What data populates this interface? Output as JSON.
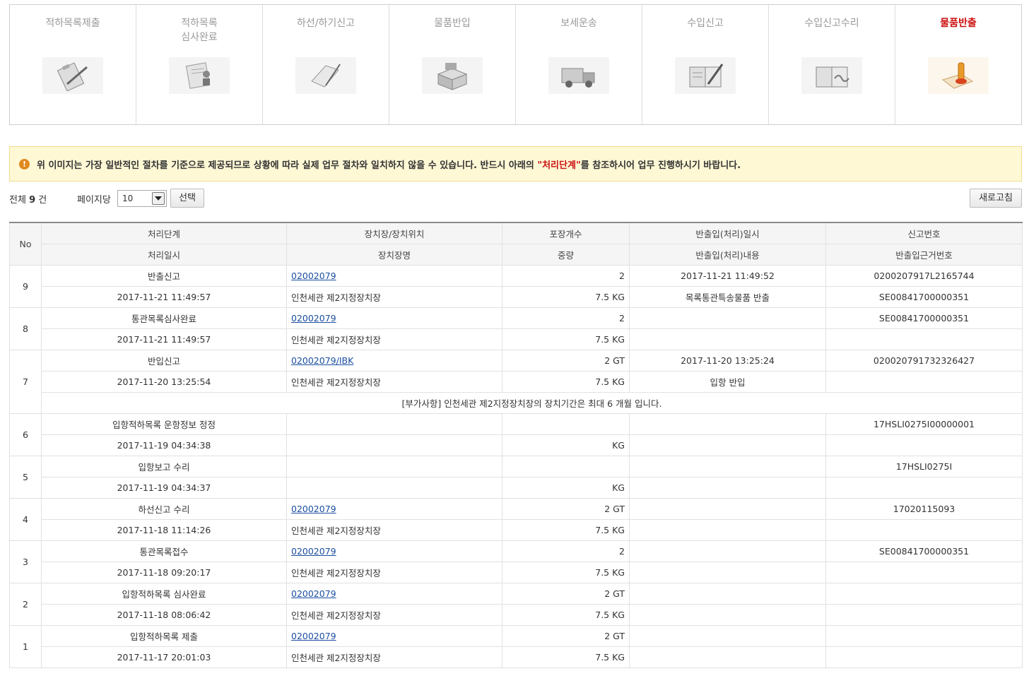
{
  "steps": [
    {
      "label": "적하목록제출",
      "icon": "clipboard-pencil-icon",
      "active": false
    },
    {
      "label": "적하목록\n심사완료",
      "icon": "stamp-document-icon",
      "active": false
    },
    {
      "label": "하선/하기신고",
      "icon": "pen-paper-icon",
      "active": false
    },
    {
      "label": "물품반입",
      "icon": "boxes-icon",
      "active": false
    },
    {
      "label": "보세운송",
      "icon": "truck-icon",
      "active": false
    },
    {
      "label": "수입신고",
      "icon": "book-pen-icon",
      "active": false
    },
    {
      "label": "수입신고수리",
      "icon": "book-signature-icon",
      "active": false
    },
    {
      "label": "물품반출",
      "icon": "seal-document-icon",
      "active": true
    }
  ],
  "notice": {
    "icon": "exclamation-icon",
    "text_before": "위 이미지는 가장 일반적인 절차를 기준으로 제공되므로 상황에 따라 실제 업무 절차와 일치하지 않을 수 있습니다. 반드시 아래의 ",
    "highlight": "\"처리단계\"",
    "text_after": "를 참조하시어 업무 진행하시기 바랍니다."
  },
  "toolbar": {
    "total_prefix": "전체",
    "total_count": "9",
    "total_suffix": "건",
    "perpage_label": "페이지당",
    "perpage_value": "10",
    "select_button": "선택",
    "refresh_button": "새로고침"
  },
  "table": {
    "headers": {
      "no": "No",
      "row1": [
        "처리단계",
        "장치장/장치위치",
        "포장개수",
        "반출입(처리)일시",
        "신고번호"
      ],
      "row2": [
        "처리일시",
        "장치장명",
        "중량",
        "반출입(처리)내용",
        "반출입근거번호"
      ]
    },
    "records": [
      {
        "no": "9",
        "step": "반출신고",
        "location": "02002079",
        "pkg": "2",
        "io_datetime": "2017-11-21 11:49:52",
        "decl_no": "0200207917L2165744",
        "datetime": "2017-11-21 11:49:57",
        "warehouse": "인천세관 제2지정장치장",
        "weight": "7.5 KG",
        "io_content": "목록통관특송물품 반출",
        "basis_no": "SE00841700000351"
      },
      {
        "no": "8",
        "step": "통관목록심사완료",
        "location": "02002079",
        "pkg": "2",
        "io_datetime": "",
        "decl_no": "SE00841700000351",
        "datetime": "2017-11-21 11:49:57",
        "warehouse": "인천세관 제2지정장치장",
        "weight": "7.5 KG",
        "io_content": "",
        "basis_no": ""
      },
      {
        "no": "7",
        "step": "반입신고",
        "location": "02002079/IBK",
        "pkg": "2 GT",
        "io_datetime": "2017-11-20 13:25:24",
        "decl_no": "020020791732326427",
        "datetime": "2017-11-20 13:25:54",
        "warehouse": "인천세관 제2지정장치장",
        "weight": "7.5 KG",
        "io_content": "입항 반입",
        "basis_no": "",
        "note": "[부가사항] 인천세관 제2지정장치장의 장치기간은 최대 6 개월 입니다."
      },
      {
        "no": "6",
        "step": "입항적하목록 운항정보 정정",
        "location": "",
        "pkg": "",
        "io_datetime": "",
        "decl_no": "17HSLI0275I00000001",
        "datetime": "2017-11-19 04:34:38",
        "warehouse": "",
        "weight": "KG",
        "io_content": "",
        "basis_no": ""
      },
      {
        "no": "5",
        "step": "입항보고 수리",
        "location": "",
        "pkg": "",
        "io_datetime": "",
        "decl_no": "17HSLI0275I",
        "datetime": "2017-11-19 04:34:37",
        "warehouse": "",
        "weight": "KG",
        "io_content": "",
        "basis_no": ""
      },
      {
        "no": "4",
        "step": "하선신고 수리",
        "location": "02002079",
        "pkg": "2 GT",
        "io_datetime": "",
        "decl_no": "17020115093",
        "datetime": "2017-11-18 11:14:26",
        "warehouse": "인천세관 제2지정장치장",
        "weight": "7.5 KG",
        "io_content": "",
        "basis_no": ""
      },
      {
        "no": "3",
        "step": "통관목록접수",
        "location": "02002079",
        "pkg": "2",
        "io_datetime": "",
        "decl_no": "SE00841700000351",
        "datetime": "2017-11-18 09:20:17",
        "warehouse": "인천세관 제2지정장치장",
        "weight": "7.5 KG",
        "io_content": "",
        "basis_no": ""
      },
      {
        "no": "2",
        "step": "입항적하목록 심사완료",
        "location": "02002079",
        "pkg": "2 GT",
        "io_datetime": "",
        "decl_no": "",
        "datetime": "2017-11-18 08:06:42",
        "warehouse": "인천세관 제2지정장치장",
        "weight": "7.5 KG",
        "io_content": "",
        "basis_no": ""
      },
      {
        "no": "1",
        "step": "입항적하목록 제출",
        "location": "02002079",
        "pkg": "2 GT",
        "io_datetime": "",
        "decl_no": "",
        "datetime": "2017-11-17 20:01:03",
        "warehouse": "인천세관 제2지정장치장",
        "weight": "7.5 KG",
        "io_content": "",
        "basis_no": ""
      }
    ]
  },
  "colors": {
    "active_step": "#cc1111",
    "link": "#1a4ea0",
    "notice_bg": "#fff8d5",
    "notice_icon": "#e08a1e"
  }
}
